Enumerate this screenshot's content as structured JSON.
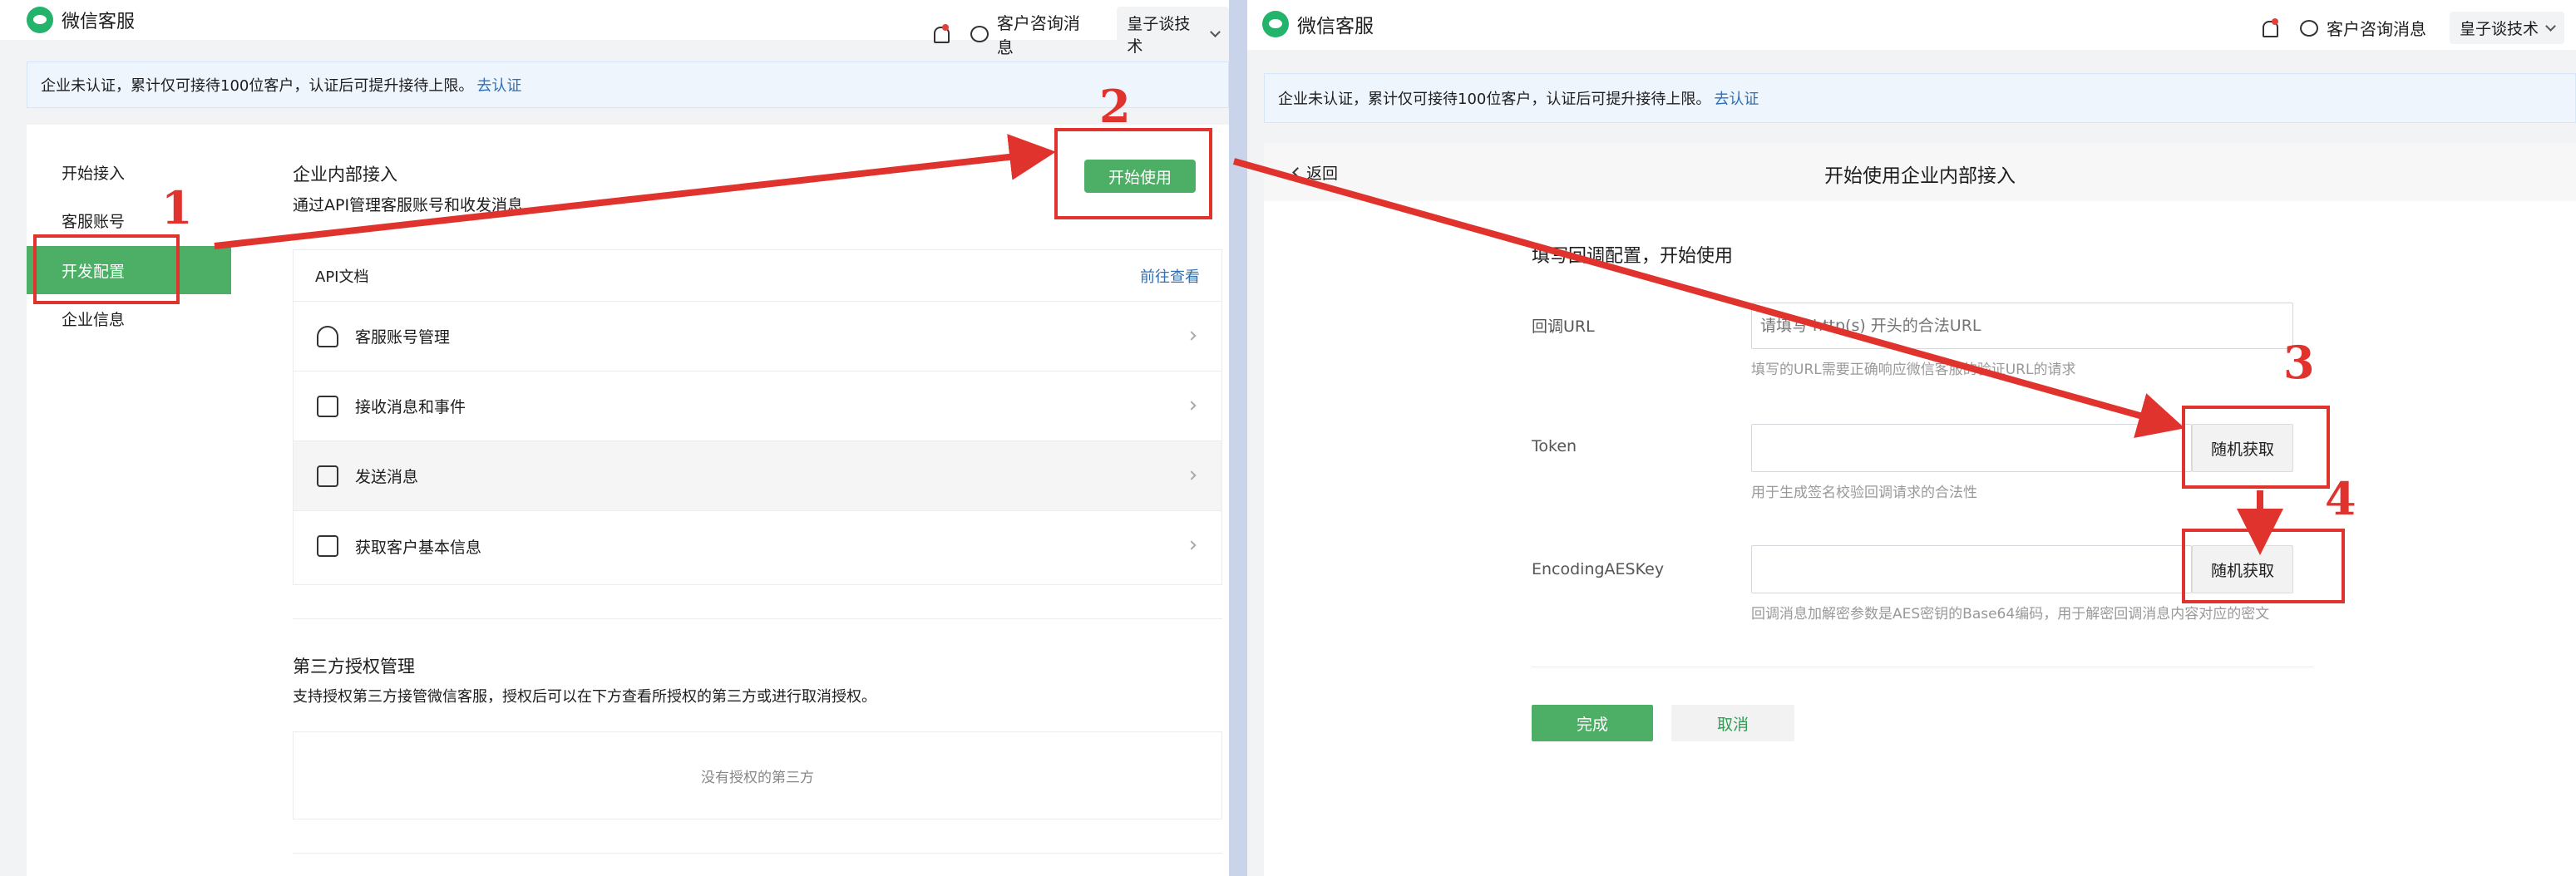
{
  "brand": "微信客服",
  "topbar": {
    "consult": "客户咨询消息",
    "org": "皇子谈技术"
  },
  "notice": {
    "text": "企业未认证，累计仅可接待100位客户，认证后可提升接待上限。",
    "link": "去认证"
  },
  "left": {
    "nav": [
      "开始接入",
      "客服账号",
      "开发配置",
      "企业信息"
    ],
    "section_title": "企业内部接入",
    "section_sub": "通过API管理客服账号和收发消息",
    "start_button": "开始使用",
    "api": {
      "title": "API文档",
      "link": "前往查看",
      "items": [
        "客服账号管理",
        "接收消息和事件",
        "发送消息",
        "获取客户基本信息"
      ]
    },
    "third_title": "第三方授权管理",
    "third_sub": "支持授权第三方接管微信客服，授权后可以在下方查看所授权的第三方或进行取消授权。",
    "third_empty": "没有授权的第三方"
  },
  "right": {
    "back": "返回",
    "title": "开始使用企业内部接入",
    "form_title": "填写回调配置，开始使用",
    "url_label": "回调URL",
    "url_placeholder": "请填写 http(s) 开头的合法URL",
    "url_hint": "填写的URL需要正确响应微信客服的验证URL的请求",
    "token_label": "Token",
    "token_hint": "用于生成签名校验回调请求的合法性",
    "aes_label": "EncodingAESKey",
    "aes_hint": "回调消息加解密参数是AES密钥的Base64编码，用于解密回调消息内容对应的密文",
    "random_button": "随机获取",
    "done_button": "完成",
    "cancel_button": "取消"
  },
  "annotations": [
    "1",
    "2",
    "3",
    "4"
  ],
  "colors": {
    "accent": "#4caf65",
    "annotation": "#e0332e",
    "link": "#2f6fb2"
  }
}
